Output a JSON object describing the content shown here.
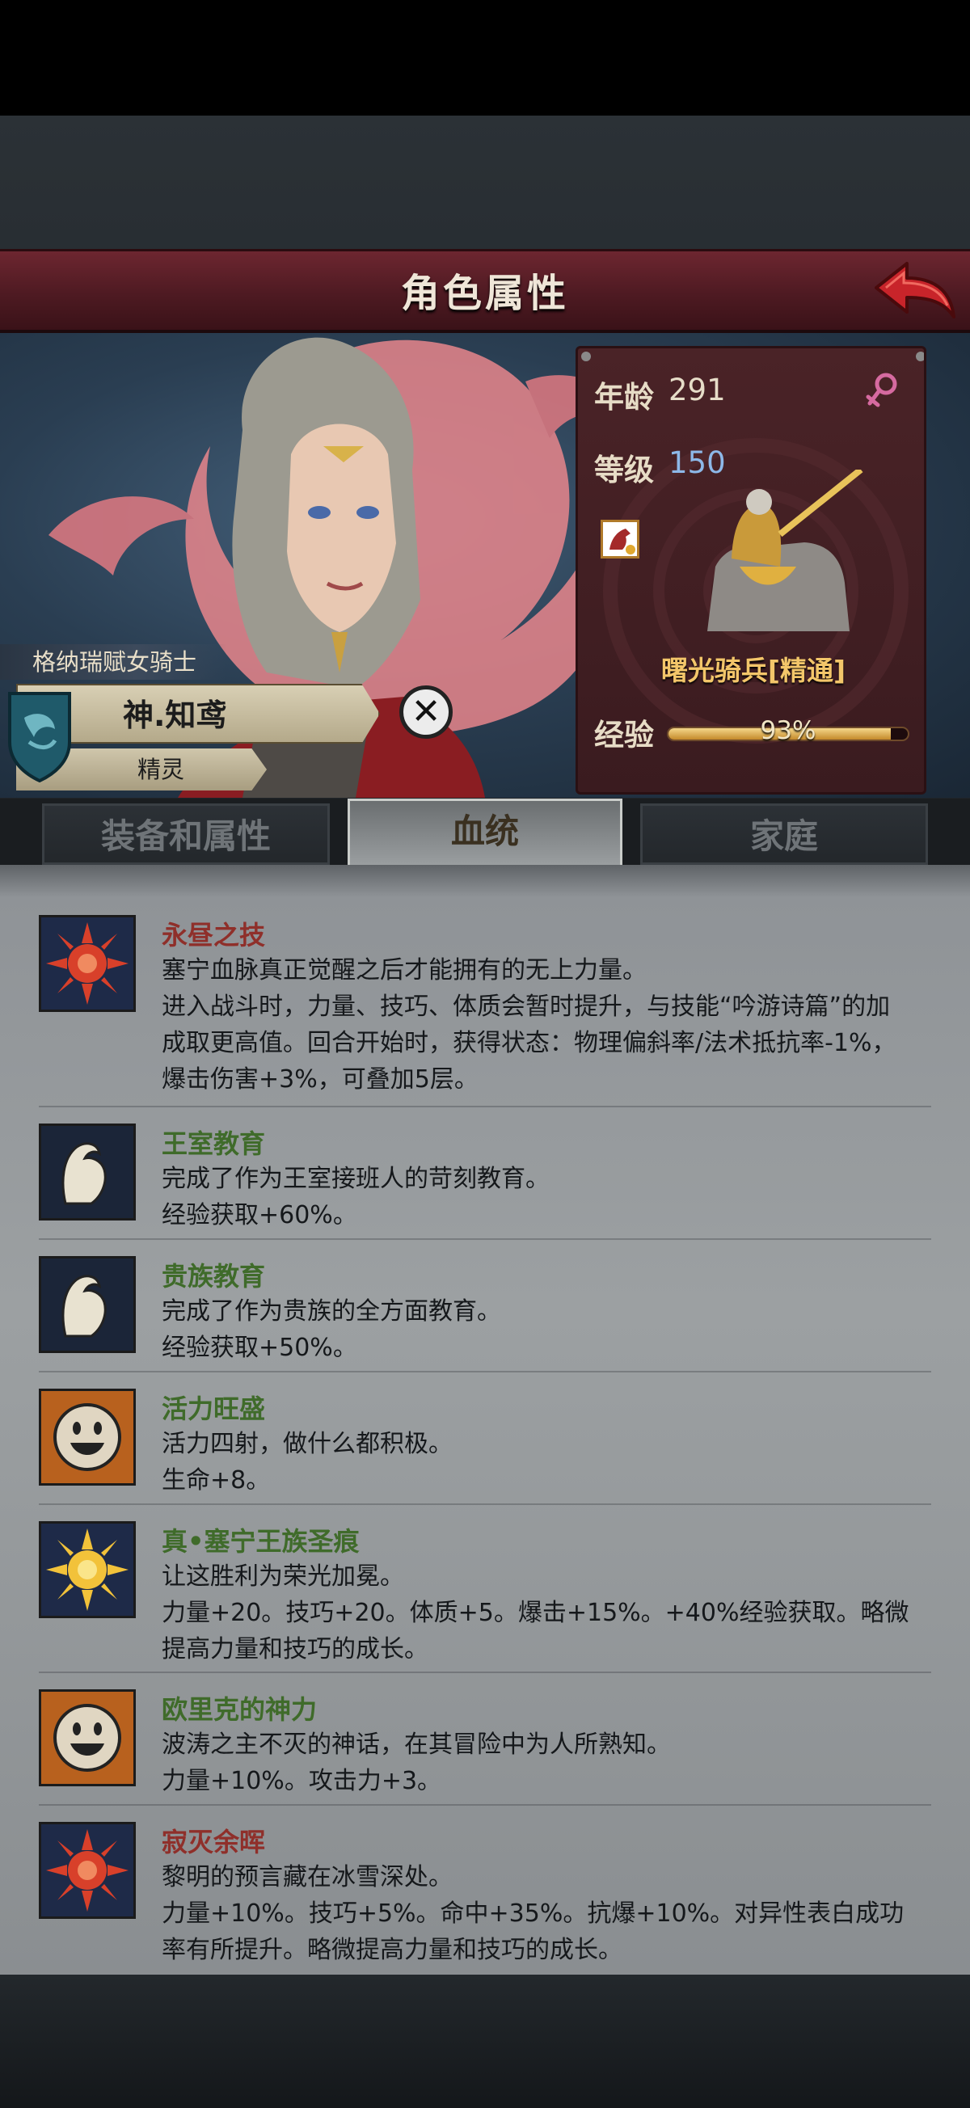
{
  "header": {
    "title": "角色属性",
    "back_icon": "red-back-arrow-icon"
  },
  "character": {
    "class_title": "格纳瑞赋女骑士",
    "name": "神.知鸢",
    "rank": "精灵"
  },
  "stats": {
    "age_label": "年龄",
    "age_value": "291",
    "gender_icon": "female-symbol-icon",
    "level_label": "等级",
    "level_value": "150",
    "mount_name": "曙光骑兵[精通]",
    "exp_label": "经验",
    "exp_percent_text": "93%",
    "exp_fraction": 0.93,
    "colors": {
      "age_value": "#e6ddc8",
      "level_value": "#8db8e8",
      "gender": "#d66aa0"
    }
  },
  "tabs": [
    {
      "label": "装备和属性",
      "active": false
    },
    {
      "label": "血统",
      "active": true
    },
    {
      "label": "家庭",
      "active": false
    }
  ],
  "traits": [
    {
      "title": "永昼之技",
      "title_color": "red",
      "icon": "red-sun-icon",
      "lines": [
        "塞宁血脉真正觉醒之后才能拥有的无上力量。",
        "进入战斗时，力量、技巧、体质会暂时提升，与技能“吟游诗篇”的加",
        "成取更高值。回合开始时，获得状态：物理偏斜率/法术抵抗率-1%，",
        "爆击伤害+3%，可叠加5层。"
      ]
    },
    {
      "title": "王室教育",
      "title_color": "green",
      "icon": "flexed-arm-icon",
      "lines": [
        "完成了作为王室接班人的苛刻教育。",
        "经验获取+60%。"
      ]
    },
    {
      "title": "贵族教育",
      "title_color": "green",
      "icon": "flexed-arm-icon",
      "lines": [
        "完成了作为贵族的全方面教育。",
        "经验获取+50%。"
      ]
    },
    {
      "title": "活力旺盛",
      "title_color": "green",
      "icon": "smiley-face-icon",
      "lines": [
        "活力四射，做什么都积极。",
        "生命+8。"
      ]
    },
    {
      "title": "真•塞宁王族圣痕",
      "title_color": "green",
      "icon": "golden-sun-icon",
      "lines": [
        "让这胜利为荣光加冕。",
        "力量+20。技巧+20。体质+5。爆击+15%。+40%经验获取。略微",
        "提高力量和技巧的成长。"
      ]
    },
    {
      "title": "欧里克的神力",
      "title_color": "green",
      "icon": "smiley-face-icon",
      "lines": [
        "波涛之主不灭的神话，在其冒险中为人所熟知。",
        "力量+10%。攻击力+3。"
      ]
    },
    {
      "title": "寂灭余晖",
      "title_color": "red",
      "icon": "red-sun-icon",
      "lines": [
        "黎明的预言藏在冰雪深处。",
        "力量+10%。技巧+5%。命中+35%。抗爆+10%。对异性表白成功",
        "率有所提升。略微提高力量和技巧的成长。"
      ]
    }
  ]
}
